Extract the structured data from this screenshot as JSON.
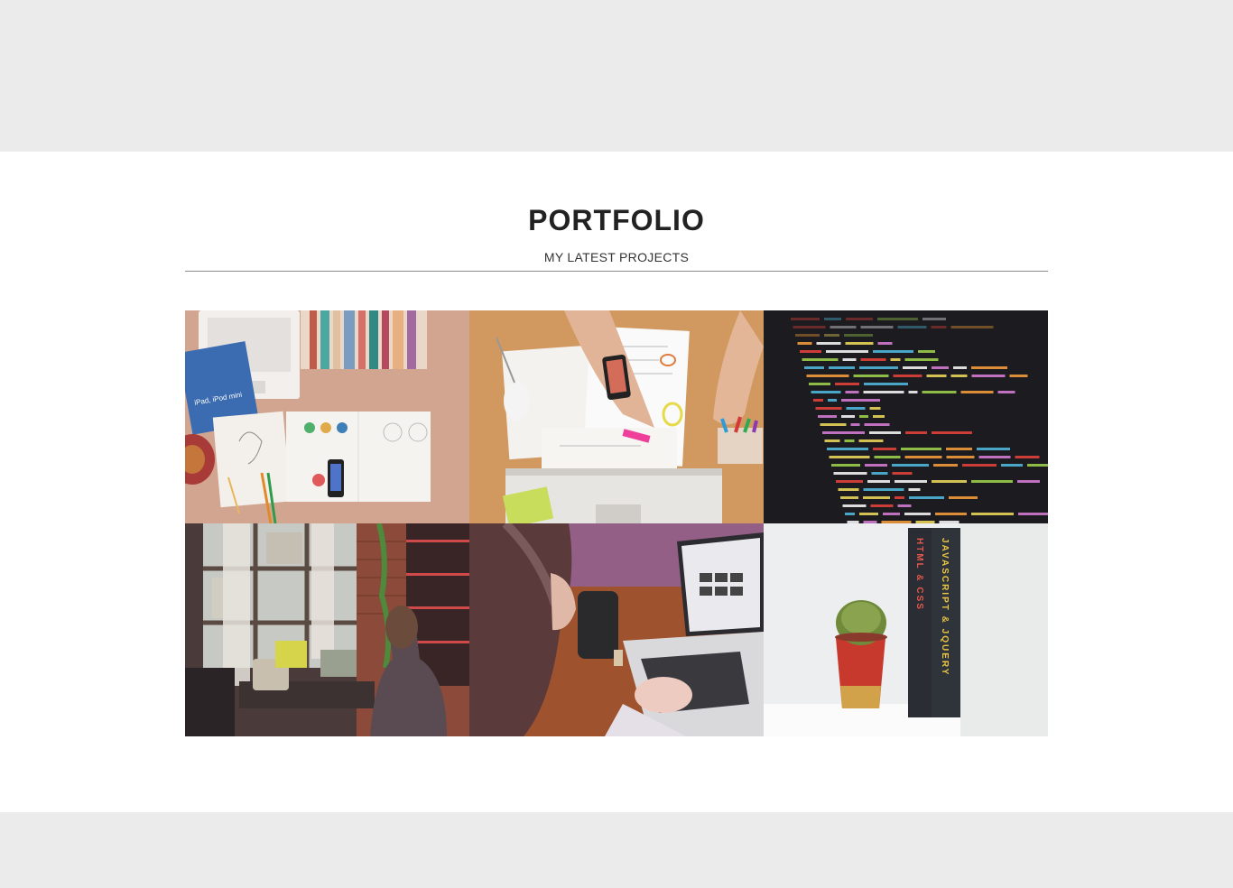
{
  "portfolio": {
    "title": "PORTFOLIO",
    "subtitle": "MY LATEST PROJECTS",
    "items": [
      {
        "name": "desk-with-laptop-and-books",
        "book_text": "iPad, iPod mini"
      },
      {
        "name": "hands-drawing-wireframes"
      },
      {
        "name": "code-on-screen"
      },
      {
        "name": "woman-working-by-window"
      },
      {
        "name": "woman-with-coffee-and-laptop"
      },
      {
        "name": "cactus-and-books",
        "book1": "HTML & CSS",
        "book2": "JAVASCRIPT & JQUERY"
      }
    ]
  },
  "colors": {
    "page_band": "#ebebeb",
    "section_bg": "#ffffff",
    "rule": "#8a8a8a"
  }
}
